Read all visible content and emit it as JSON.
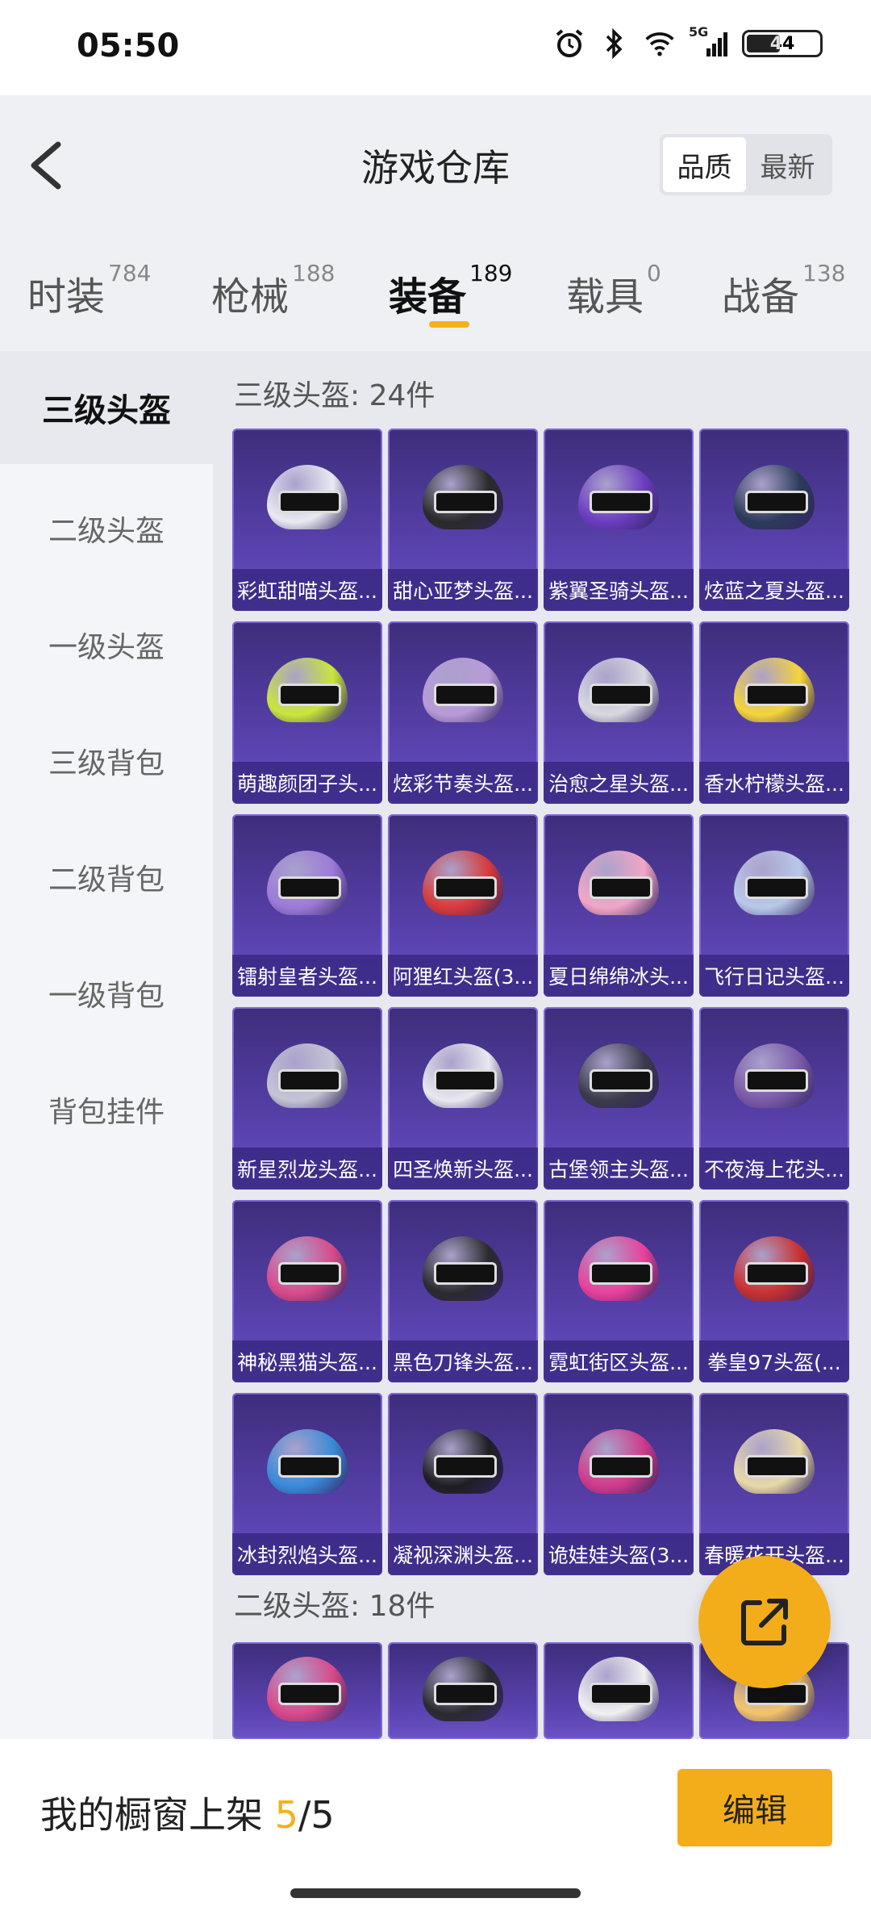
{
  "status": {
    "time": "05:50",
    "battery": "44",
    "network": "5G"
  },
  "header": {
    "title": "游戏仓库",
    "sort_options": [
      "品质",
      "最新"
    ],
    "sort_active": "品质"
  },
  "tabs": [
    {
      "label": "时装",
      "count": "784"
    },
    {
      "label": "枪械",
      "count": "188"
    },
    {
      "label": "装备",
      "count": "189"
    },
    {
      "label": "载具",
      "count": "0"
    },
    {
      "label": "战备",
      "count": "138"
    }
  ],
  "active_tab": "装备",
  "sidebar": {
    "items": [
      "三级头盔",
      "二级头盔",
      "一级头盔",
      "三级背包",
      "二级背包",
      "一级背包",
      "背包挂件"
    ],
    "active": "三级头盔"
  },
  "sections": [
    {
      "title": "三级头盔: 24件",
      "items": [
        {
          "name": "彩虹甜喵头盔...",
          "color": "#e8eaf2"
        },
        {
          "name": "甜心亚梦头盔...",
          "color": "#2a2a2a"
        },
        {
          "name": "紫翼圣骑头盔...",
          "color": "#6b3cc0"
        },
        {
          "name": "炫蓝之夏头盔...",
          "color": "#2c3b5a"
        },
        {
          "name": "萌趣颜团子头...",
          "color": "#c9e63a"
        },
        {
          "name": "炫彩节奏头盔...",
          "color": "#b89ad8"
        },
        {
          "name": "治愈之星头盔...",
          "color": "#d8d8e0"
        },
        {
          "name": "香水柠檬头盔...",
          "color": "#f5d43a"
        },
        {
          "name": "镭射皇者头盔...",
          "color": "#9c7ad8"
        },
        {
          "name": "阿狸红头盔(3...",
          "color": "#d83a3a"
        },
        {
          "name": "夏日绵绵冰头...",
          "color": "#f2a6c6"
        },
        {
          "name": "飞行日记头盔...",
          "color": "#b8c8e8"
        },
        {
          "name": "新星烈龙头盔...",
          "color": "#c4c4d4"
        },
        {
          "name": "四圣焕新头盔...",
          "color": "#e8e8f0"
        },
        {
          "name": "古堡领主头盔...",
          "color": "#3a3a4a"
        },
        {
          "name": "不夜海上花头...",
          "color": "#7a5aa8"
        },
        {
          "name": "神秘黑猫头盔...",
          "color": "#d84a8a"
        },
        {
          "name": "黑色刀锋头盔...",
          "color": "#2a2a2e"
        },
        {
          "name": "霓虹街区头盔...",
          "color": "#e8409a"
        },
        {
          "name": "拳皇97头盔(...",
          "color": "#c83030"
        },
        {
          "name": "冰封烈焰头盔...",
          "color": "#3a8ad8"
        },
        {
          "name": "凝视深渊头盔...",
          "color": "#1e1e22"
        },
        {
          "name": "诡娃娃头盔(3...",
          "color": "#d03a8a"
        },
        {
          "name": "春暖花开头盔...",
          "color": "#e8d8a8"
        }
      ]
    },
    {
      "title": "二级头盔: 18件",
      "items": [
        {
          "name": "",
          "color": "#d84a8a"
        },
        {
          "name": "",
          "color": "#2a2a2e"
        },
        {
          "name": "",
          "color": "#f0f0f0"
        },
        {
          "name": "",
          "color": "#f2c46a"
        }
      ]
    }
  ],
  "bottom": {
    "prefix": "我的橱窗上架 ",
    "current": "5",
    "suffix": "/5",
    "edit_label": "编辑"
  }
}
